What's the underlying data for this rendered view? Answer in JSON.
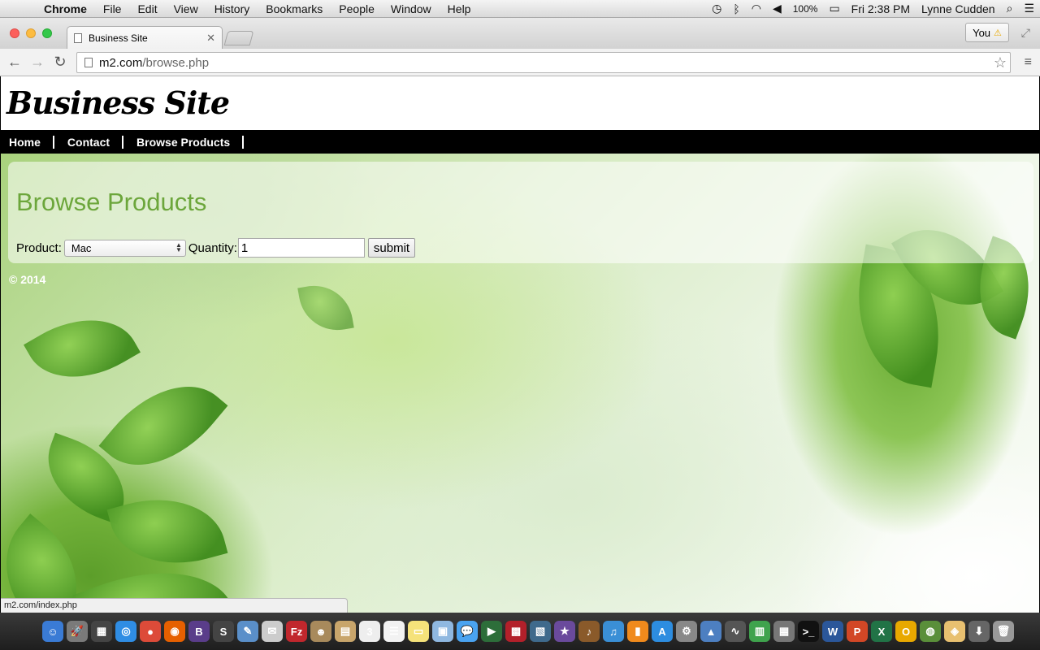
{
  "menubar": {
    "app_name": "Chrome",
    "items": [
      "File",
      "Edit",
      "View",
      "History",
      "Bookmarks",
      "People",
      "Window",
      "Help"
    ],
    "battery": "100%",
    "clock": "Fri 2:38 PM",
    "user": "Lynne Cudden"
  },
  "browser": {
    "tab_title": "Business Site",
    "profile_label": "You",
    "url_host": "m2.com",
    "url_path": "/browse.php",
    "status_url": "m2.com/index.php"
  },
  "site": {
    "logo": "Business Site",
    "nav": [
      "Home",
      "Contact",
      "Browse Products"
    ],
    "heading": "Browse Products",
    "form": {
      "product_label": "Product:",
      "product_value": "Mac",
      "quantity_label": "Quantity:",
      "quantity_value": "1",
      "submit_label": "submit"
    },
    "footer": "© 2014"
  },
  "dock": {
    "icons": [
      {
        "name": "finder-icon",
        "color": "#3a7bd5",
        "glyph": "☺"
      },
      {
        "name": "launchpad-icon",
        "color": "#7a7a7a",
        "glyph": "🚀"
      },
      {
        "name": "mission-control-icon",
        "color": "#444",
        "glyph": "▦"
      },
      {
        "name": "safari-icon",
        "color": "#2f8de4",
        "glyph": "◎"
      },
      {
        "name": "chrome-icon",
        "color": "#dd4b39",
        "glyph": "●"
      },
      {
        "name": "firefox-icon",
        "color": "#e66000",
        "glyph": "◉"
      },
      {
        "name": "bbedit-icon",
        "color": "#5a3d8a",
        "glyph": "B"
      },
      {
        "name": "sublime-icon",
        "color": "#444",
        "glyph": "S"
      },
      {
        "name": "preview-icon",
        "color": "#5a8fc9",
        "glyph": "✎"
      },
      {
        "name": "script-editor-icon",
        "color": "#ccc",
        "glyph": "✉"
      },
      {
        "name": "filezilla-icon",
        "color": "#c1272d",
        "glyph": "Fz"
      },
      {
        "name": "contacts-icon",
        "color": "#a88a5c",
        "glyph": "☻"
      },
      {
        "name": "notes-app-icon",
        "color": "#c8a56b",
        "glyph": "▤"
      },
      {
        "name": "calendar-icon",
        "color": "#eee",
        "glyph": "3"
      },
      {
        "name": "reminders-icon",
        "color": "#f2f2f2",
        "glyph": "☰"
      },
      {
        "name": "stickies-icon",
        "color": "#f5e27a",
        "glyph": "▭"
      },
      {
        "name": "photos-icon",
        "color": "#8fb8e0",
        "glyph": "▣"
      },
      {
        "name": "messages-icon",
        "color": "#4aa3f0",
        "glyph": "💬"
      },
      {
        "name": "facetime-icon",
        "color": "#2d6e3a",
        "glyph": "▶"
      },
      {
        "name": "photo-booth-icon",
        "color": "#b3202a",
        "glyph": "▩"
      },
      {
        "name": "image-capture-icon",
        "color": "#3f6a8c",
        "glyph": "▧"
      },
      {
        "name": "imovie-icon",
        "color": "#6a4a9c",
        "glyph": "★"
      },
      {
        "name": "garageband-icon",
        "color": "#8a5a2a",
        "glyph": "♪"
      },
      {
        "name": "itunes-icon",
        "color": "#3a8fd6",
        "glyph": "♫"
      },
      {
        "name": "ibooks-icon",
        "color": "#f08a1c",
        "glyph": "▮"
      },
      {
        "name": "app-store-icon",
        "color": "#2d8de0",
        "glyph": "A"
      },
      {
        "name": "system-preferences-icon",
        "color": "#888",
        "glyph": "⚙"
      },
      {
        "name": "keynote-icon",
        "color": "#4d7fc1",
        "glyph": "▲"
      },
      {
        "name": "grapher-icon",
        "color": "#555",
        "glyph": "∿"
      },
      {
        "name": "numbers-icon",
        "color": "#3fa34d",
        "glyph": "▥"
      },
      {
        "name": "calculator-icon",
        "color": "#777",
        "glyph": "▦"
      },
      {
        "name": "terminal-icon",
        "color": "#111",
        "glyph": ">_"
      },
      {
        "name": "word-icon",
        "color": "#2b579a",
        "glyph": "W"
      },
      {
        "name": "powerpoint-icon",
        "color": "#d24726",
        "glyph": "P"
      },
      {
        "name": "excel-icon",
        "color": "#217346",
        "glyph": "X"
      },
      {
        "name": "outlook-icon",
        "color": "#e8a800",
        "glyph": "O"
      },
      {
        "name": "network-icon",
        "color": "#5a8f3a",
        "glyph": "◍"
      },
      {
        "name": "color-palette-icon",
        "color": "#e8c070",
        "glyph": "◈"
      },
      {
        "name": "downloads-stack-icon",
        "color": "#666",
        "glyph": "⬇"
      },
      {
        "name": "trash-icon",
        "color": "#999",
        "glyph": "🗑"
      }
    ]
  }
}
